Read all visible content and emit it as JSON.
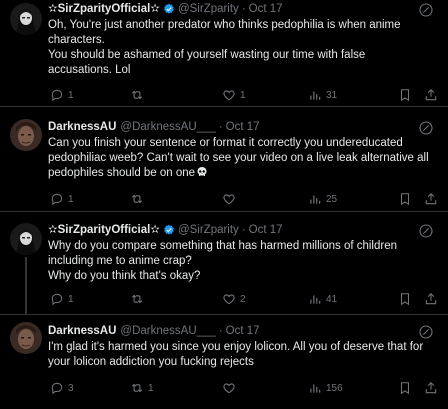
{
  "tweets": [
    {
      "name": "✫SirZparityOfficial✫",
      "handle": "@SirZparity",
      "dot": "·",
      "time": "Oct 17",
      "verified": true,
      "lines": [
        "Oh, You're just another predator who thinks pedophilia is when anime",
        "characters.",
        "You should be ashamed of yourself wasting our time with false",
        "accusations. Lol"
      ],
      "reply_count": "1",
      "retweet_count": "",
      "like_count": "1",
      "view_count": "31"
    },
    {
      "name": "DarknessAU",
      "handle": "@DarknessAU___",
      "dot": "·",
      "time": "Oct 17",
      "verified": false,
      "lines": [
        "Can you finish your sentence or format it correctly you undereducated",
        "pedophiliac weeb? Can't wait to see your video on a live leak alternative all",
        "pedophiles should be on one"
      ],
      "reply_count": "1",
      "retweet_count": "",
      "like_count": "",
      "view_count": "25"
    },
    {
      "name": "✫SirZparityOfficial✫",
      "handle": "@SirZparity",
      "dot": "·",
      "time": "Oct 17",
      "verified": true,
      "lines": [
        "Why do you compare something that has harmed millions of children",
        "including me to anime crap?",
        "Why do you think that's okay?"
      ],
      "reply_count": "1",
      "retweet_count": "",
      "like_count": "2",
      "view_count": "41"
    },
    {
      "name": "DarknessAU",
      "handle": "@DarknessAU___",
      "dot": "·",
      "time": "Oct 17",
      "verified": false,
      "lines": [
        "I'm glad it's harmed you since you enjoy lolicon. All you of deserve that for",
        "your lolicon addiction you fucking rejects"
      ],
      "reply_count": "3",
      "retweet_count": "1",
      "like_count": "",
      "view_count": "156"
    }
  ],
  "colors": {
    "background": "#000000",
    "text": "#e7e9ea",
    "muted": "#71767b",
    "verified": "#1d9bf0",
    "divider": "#2f3336"
  },
  "icons": {
    "reply": "reply-icon",
    "retweet": "retweet-icon",
    "like": "like-icon",
    "views": "views-icon",
    "bookmark": "bookmark-icon",
    "share": "share-icon",
    "more": "more-icon",
    "verified": "verified-badge-icon",
    "skull": "skull-emoji-icon"
  }
}
